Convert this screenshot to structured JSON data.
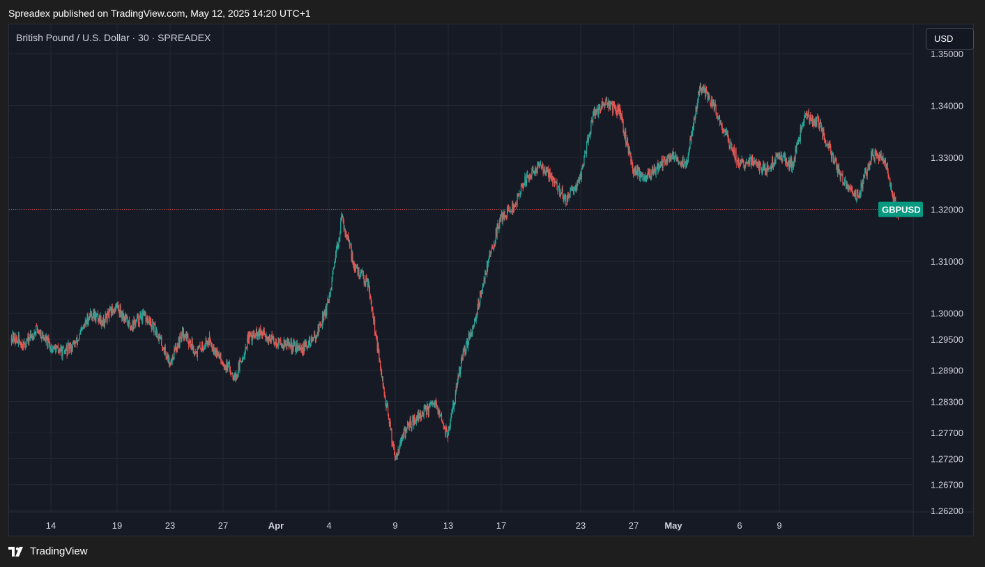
{
  "header": {
    "published_text": "Spreadex published on TradingView.com, May 12, 2025 14:20 UTC+1"
  },
  "chart_header": {
    "symbol_title": "British Pound / U.S. Dollar · 30 · SPREADEX",
    "currency_button": "USD"
  },
  "footer": {
    "brand": "TradingView"
  },
  "colors": {
    "background": "#161a25",
    "up": "#26a69a",
    "down": "#ef5350",
    "grid": "#242833",
    "badge": "#089981"
  },
  "chart_data": {
    "type": "candlestick",
    "symbol": "GBPUSD",
    "timeframe": "30",
    "currency": "USD",
    "price_line": 1.32,
    "price_label": "GBPUSD",
    "ylim": [
      1.262,
      1.35
    ],
    "y_ticks": [
      "1.35000",
      "1.34000",
      "1.33000",
      "1.32000",
      "1.31000",
      "1.30000",
      "1.29500",
      "1.28900",
      "1.28300",
      "1.27700",
      "1.27200",
      "1.26700",
      "1.26200"
    ],
    "x_ticks": [
      {
        "label": "14",
        "day": 3
      },
      {
        "label": "19",
        "day": 8
      },
      {
        "label": "23",
        "day": 12
      },
      {
        "label": "27",
        "day": 16
      },
      {
        "label": "Apr",
        "day": 20,
        "bold": true
      },
      {
        "label": "4",
        "day": 24
      },
      {
        "label": "9",
        "day": 29
      },
      {
        "label": "13",
        "day": 33
      },
      {
        "label": "17",
        "day": 37
      },
      {
        "label": "23",
        "day": 43
      },
      {
        "label": "27",
        "day": 47
      },
      {
        "label": "May",
        "day": 50,
        "bold": true
      },
      {
        "label": "6",
        "day": 55
      },
      {
        "label": "9",
        "day": 58
      }
    ],
    "path": [
      [
        0,
        1.2955
      ],
      [
        1,
        1.294
      ],
      [
        2,
        1.297
      ],
      [
        3,
        1.2935
      ],
      [
        4,
        1.2925
      ],
      [
        5,
        1.2945
      ],
      [
        6,
        1.3
      ],
      [
        7,
        1.2985
      ],
      [
        8,
        1.3015
      ],
      [
        9,
        1.2975
      ],
      [
        10,
        1.2995
      ],
      [
        11,
        1.2965
      ],
      [
        12,
        1.2905
      ],
      [
        13,
        1.2965
      ],
      [
        14,
        1.2925
      ],
      [
        15,
        1.295
      ],
      [
        16,
        1.2905
      ],
      [
        17,
        1.288
      ],
      [
        18,
        1.2955
      ],
      [
        19,
        1.296
      ],
      [
        20,
        1.2945
      ],
      [
        21,
        1.294
      ],
      [
        22,
        1.293
      ],
      [
        23,
        1.2955
      ],
      [
        24,
        1.302
      ],
      [
        25,
        1.3185
      ],
      [
        26,
        1.3085
      ],
      [
        27,
        1.306
      ],
      [
        28,
        1.2875
      ],
      [
        29,
        1.2725
      ],
      [
        30,
        1.2785
      ],
      [
        31,
        1.2805
      ],
      [
        32,
        1.2825
      ],
      [
        33,
        1.2765
      ],
      [
        34,
        1.2905
      ],
      [
        35,
        1.2985
      ],
      [
        36,
        1.3095
      ],
      [
        37,
        1.3185
      ],
      [
        38,
        1.3205
      ],
      [
        39,
        1.3265
      ],
      [
        40,
        1.3285
      ],
      [
        41,
        1.3255
      ],
      [
        42,
        1.3215
      ],
      [
        43,
        1.3265
      ],
      [
        44,
        1.3385
      ],
      [
        45,
        1.3405
      ],
      [
        46,
        1.3385
      ],
      [
        47,
        1.3275
      ],
      [
        48,
        1.3265
      ],
      [
        49,
        1.3285
      ],
      [
        50,
        1.3305
      ],
      [
        51,
        1.3285
      ],
      [
        52,
        1.3435
      ],
      [
        53,
        1.3405
      ],
      [
        54,
        1.3345
      ],
      [
        55,
        1.3285
      ],
      [
        56,
        1.3295
      ],
      [
        57,
        1.3275
      ],
      [
        58,
        1.3305
      ],
      [
        59,
        1.3285
      ],
      [
        60,
        1.3385
      ],
      [
        61,
        1.3365
      ],
      [
        62,
        1.3305
      ],
      [
        63,
        1.3245
      ],
      [
        64,
        1.3225
      ],
      [
        65,
        1.3305
      ],
      [
        66,
        1.3295
      ],
      [
        67,
        1.3185
      ]
    ]
  }
}
